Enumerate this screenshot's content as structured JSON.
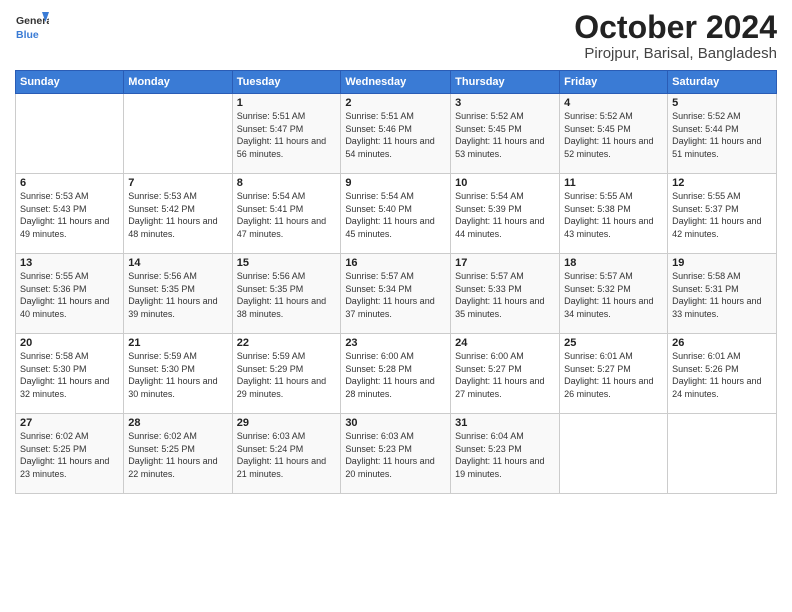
{
  "logo": {
    "general": "General",
    "blue": "Blue"
  },
  "title": "October 2024",
  "location": "Pirojpur, Barisal, Bangladesh",
  "days_header": [
    "Sunday",
    "Monday",
    "Tuesday",
    "Wednesday",
    "Thursday",
    "Friday",
    "Saturday"
  ],
  "weeks": [
    [
      {
        "day": "",
        "sunrise": "",
        "sunset": "",
        "daylight": ""
      },
      {
        "day": "",
        "sunrise": "",
        "sunset": "",
        "daylight": ""
      },
      {
        "day": "1",
        "sunrise": "Sunrise: 5:51 AM",
        "sunset": "Sunset: 5:47 PM",
        "daylight": "Daylight: 11 hours and 56 minutes."
      },
      {
        "day": "2",
        "sunrise": "Sunrise: 5:51 AM",
        "sunset": "Sunset: 5:46 PM",
        "daylight": "Daylight: 11 hours and 54 minutes."
      },
      {
        "day": "3",
        "sunrise": "Sunrise: 5:52 AM",
        "sunset": "Sunset: 5:45 PM",
        "daylight": "Daylight: 11 hours and 53 minutes."
      },
      {
        "day": "4",
        "sunrise": "Sunrise: 5:52 AM",
        "sunset": "Sunset: 5:45 PM",
        "daylight": "Daylight: 11 hours and 52 minutes."
      },
      {
        "day": "5",
        "sunrise": "Sunrise: 5:52 AM",
        "sunset": "Sunset: 5:44 PM",
        "daylight": "Daylight: 11 hours and 51 minutes."
      }
    ],
    [
      {
        "day": "6",
        "sunrise": "Sunrise: 5:53 AM",
        "sunset": "Sunset: 5:43 PM",
        "daylight": "Daylight: 11 hours and 49 minutes."
      },
      {
        "day": "7",
        "sunrise": "Sunrise: 5:53 AM",
        "sunset": "Sunset: 5:42 PM",
        "daylight": "Daylight: 11 hours and 48 minutes."
      },
      {
        "day": "8",
        "sunrise": "Sunrise: 5:54 AM",
        "sunset": "Sunset: 5:41 PM",
        "daylight": "Daylight: 11 hours and 47 minutes."
      },
      {
        "day": "9",
        "sunrise": "Sunrise: 5:54 AM",
        "sunset": "Sunset: 5:40 PM",
        "daylight": "Daylight: 11 hours and 45 minutes."
      },
      {
        "day": "10",
        "sunrise": "Sunrise: 5:54 AM",
        "sunset": "Sunset: 5:39 PM",
        "daylight": "Daylight: 11 hours and 44 minutes."
      },
      {
        "day": "11",
        "sunrise": "Sunrise: 5:55 AM",
        "sunset": "Sunset: 5:38 PM",
        "daylight": "Daylight: 11 hours and 43 minutes."
      },
      {
        "day": "12",
        "sunrise": "Sunrise: 5:55 AM",
        "sunset": "Sunset: 5:37 PM",
        "daylight": "Daylight: 11 hours and 42 minutes."
      }
    ],
    [
      {
        "day": "13",
        "sunrise": "Sunrise: 5:55 AM",
        "sunset": "Sunset: 5:36 PM",
        "daylight": "Daylight: 11 hours and 40 minutes."
      },
      {
        "day": "14",
        "sunrise": "Sunrise: 5:56 AM",
        "sunset": "Sunset: 5:35 PM",
        "daylight": "Daylight: 11 hours and 39 minutes."
      },
      {
        "day": "15",
        "sunrise": "Sunrise: 5:56 AM",
        "sunset": "Sunset: 5:35 PM",
        "daylight": "Daylight: 11 hours and 38 minutes."
      },
      {
        "day": "16",
        "sunrise": "Sunrise: 5:57 AM",
        "sunset": "Sunset: 5:34 PM",
        "daylight": "Daylight: 11 hours and 37 minutes."
      },
      {
        "day": "17",
        "sunrise": "Sunrise: 5:57 AM",
        "sunset": "Sunset: 5:33 PM",
        "daylight": "Daylight: 11 hours and 35 minutes."
      },
      {
        "day": "18",
        "sunrise": "Sunrise: 5:57 AM",
        "sunset": "Sunset: 5:32 PM",
        "daylight": "Daylight: 11 hours and 34 minutes."
      },
      {
        "day": "19",
        "sunrise": "Sunrise: 5:58 AM",
        "sunset": "Sunset: 5:31 PM",
        "daylight": "Daylight: 11 hours and 33 minutes."
      }
    ],
    [
      {
        "day": "20",
        "sunrise": "Sunrise: 5:58 AM",
        "sunset": "Sunset: 5:30 PM",
        "daylight": "Daylight: 11 hours and 32 minutes."
      },
      {
        "day": "21",
        "sunrise": "Sunrise: 5:59 AM",
        "sunset": "Sunset: 5:30 PM",
        "daylight": "Daylight: 11 hours and 30 minutes."
      },
      {
        "day": "22",
        "sunrise": "Sunrise: 5:59 AM",
        "sunset": "Sunset: 5:29 PM",
        "daylight": "Daylight: 11 hours and 29 minutes."
      },
      {
        "day": "23",
        "sunrise": "Sunrise: 6:00 AM",
        "sunset": "Sunset: 5:28 PM",
        "daylight": "Daylight: 11 hours and 28 minutes."
      },
      {
        "day": "24",
        "sunrise": "Sunrise: 6:00 AM",
        "sunset": "Sunset: 5:27 PM",
        "daylight": "Daylight: 11 hours and 27 minutes."
      },
      {
        "day": "25",
        "sunrise": "Sunrise: 6:01 AM",
        "sunset": "Sunset: 5:27 PM",
        "daylight": "Daylight: 11 hours and 26 minutes."
      },
      {
        "day": "26",
        "sunrise": "Sunrise: 6:01 AM",
        "sunset": "Sunset: 5:26 PM",
        "daylight": "Daylight: 11 hours and 24 minutes."
      }
    ],
    [
      {
        "day": "27",
        "sunrise": "Sunrise: 6:02 AM",
        "sunset": "Sunset: 5:25 PM",
        "daylight": "Daylight: 11 hours and 23 minutes."
      },
      {
        "day": "28",
        "sunrise": "Sunrise: 6:02 AM",
        "sunset": "Sunset: 5:25 PM",
        "daylight": "Daylight: 11 hours and 22 minutes."
      },
      {
        "day": "29",
        "sunrise": "Sunrise: 6:03 AM",
        "sunset": "Sunset: 5:24 PM",
        "daylight": "Daylight: 11 hours and 21 minutes."
      },
      {
        "day": "30",
        "sunrise": "Sunrise: 6:03 AM",
        "sunset": "Sunset: 5:23 PM",
        "daylight": "Daylight: 11 hours and 20 minutes."
      },
      {
        "day": "31",
        "sunrise": "Sunrise: 6:04 AM",
        "sunset": "Sunset: 5:23 PM",
        "daylight": "Daylight: 11 hours and 19 minutes."
      },
      {
        "day": "",
        "sunrise": "",
        "sunset": "",
        "daylight": ""
      },
      {
        "day": "",
        "sunrise": "",
        "sunset": "",
        "daylight": ""
      }
    ]
  ]
}
